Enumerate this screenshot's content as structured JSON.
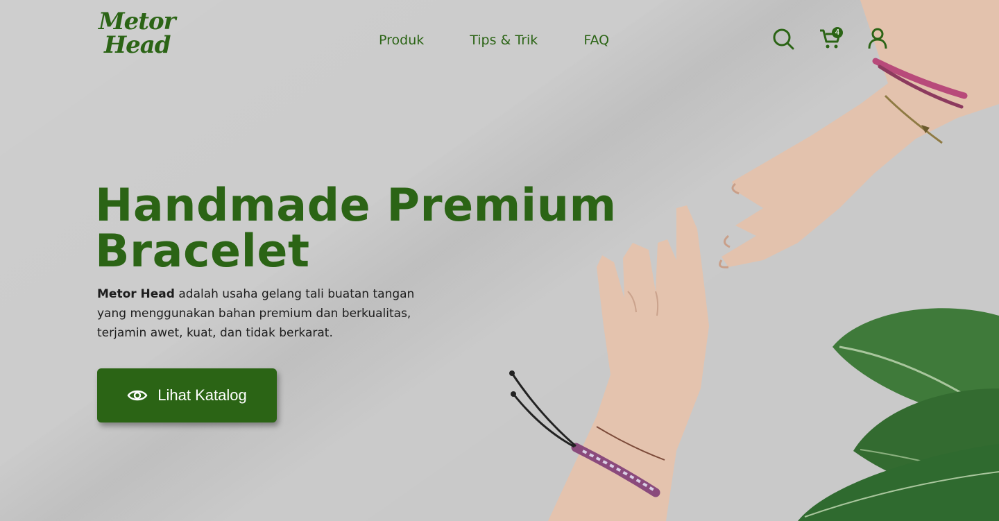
{
  "brand": {
    "logo_line1": "Metor",
    "logo_line2": "Head",
    "color": "#2b6415"
  },
  "nav": [
    {
      "label": "Produk"
    },
    {
      "label": "Tips & Trik"
    },
    {
      "label": "FAQ"
    }
  ],
  "header_icons": {
    "search": "search-icon",
    "cart": "cart-icon",
    "cart_count": "4",
    "account": "user-icon"
  },
  "hero": {
    "title_line1": "Handmade Premium",
    "title_line2": "Bracelet",
    "desc_strong": "Metor Head",
    "desc_line1": "adalah usaha gelang tali buatan tangan",
    "desc_line2": "yang menggunakan bahan premium dan berkualitas,",
    "desc_line3": "terjamin awet, kuat, dan tidak berkarat.",
    "cta_label": "Lihat Katalog",
    "cta_icon": "eye-icon"
  }
}
